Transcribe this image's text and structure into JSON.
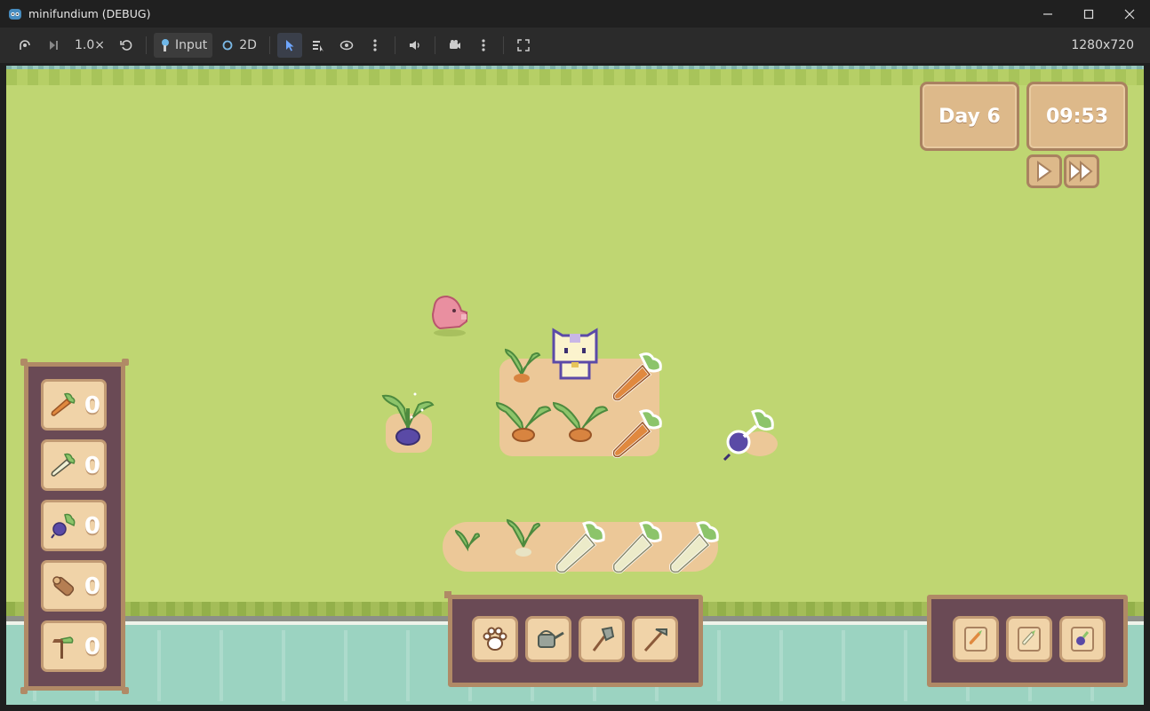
{
  "window": {
    "title": "minifundium (DEBUG)",
    "controls": [
      "minimize-icon",
      "maximize-icon",
      "close-icon"
    ]
  },
  "toolbar": {
    "speed": "1.0×",
    "input_label": "Input",
    "mode_label": "2D",
    "resolution": "1280x720",
    "icons": [
      "remote-debug-icon",
      "step-frame-icon",
      "reset-icon",
      "select-arrow-icon",
      "list-select-icon",
      "visibility-icon",
      "more-icon",
      "audio-icon",
      "camera-icon",
      "more-icon",
      "fullscreen-icon"
    ]
  },
  "hud": {
    "day": "Day 6",
    "time": "09:53",
    "play_icon": "play-icon",
    "fast_forward_icon": "fast-forward-icon"
  },
  "inventory": [
    {
      "item": "carrot-icon",
      "count": "0"
    },
    {
      "item": "parsnip-icon",
      "count": "0"
    },
    {
      "item": "beet-icon",
      "count": "0"
    },
    {
      "item": "wood-icon",
      "count": "0"
    },
    {
      "item": "sapling-icon",
      "count": "0"
    }
  ],
  "tools": [
    "paw-icon",
    "watering-can-icon",
    "shovel-icon",
    "hoe-icon"
  ],
  "seeds": [
    "carrot-seed-icon",
    "parsnip-seed-icon",
    "beet-seed-icon"
  ],
  "colors": {
    "grass": "#bfd672",
    "water": "#9bd3c1",
    "panel": "#6a4a55",
    "wood": "#b08a66",
    "button": "#f0d3a8"
  }
}
